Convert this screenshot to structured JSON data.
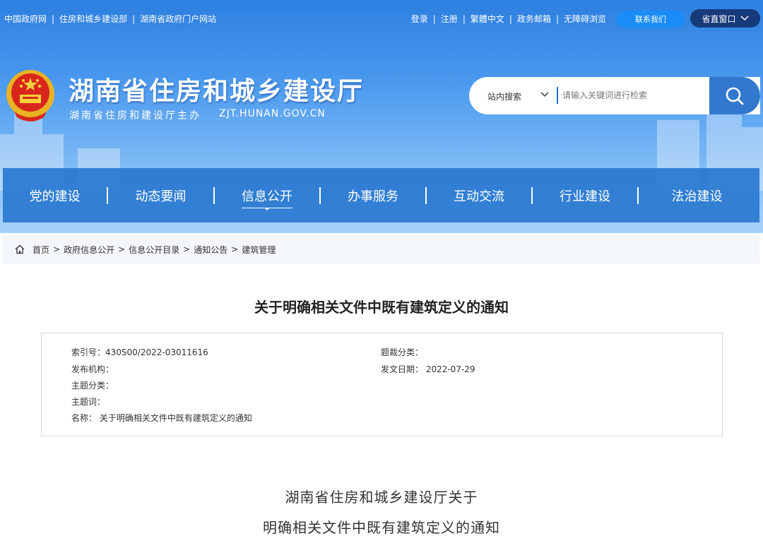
{
  "topbar": {
    "left_links": [
      "中国政府网",
      "住房和城乡建设部",
      "湖南省政府门户网站"
    ],
    "right_links": [
      "登录",
      "注册",
      "繁體中文",
      "政务邮箱",
      "无障碍浏览"
    ],
    "contact_button": "联系我们",
    "province_button": "省直窗口"
  },
  "header": {
    "title": "湖南省住房和城乡建设厅",
    "subtitle": "湖南省住房和建设厅主办",
    "url": "ZJT.HUNAN.GOV.CN"
  },
  "search": {
    "scope": "站内搜索",
    "placeholder": "请输入关键词进行检索"
  },
  "nav": {
    "items": [
      {
        "label": "党的建设"
      },
      {
        "label": "动态要闻"
      },
      {
        "label": "信息公开"
      },
      {
        "label": "办事服务"
      },
      {
        "label": "互动交流"
      },
      {
        "label": "行业建设"
      },
      {
        "label": "法治建设"
      }
    ],
    "active_index": 2
  },
  "breadcrumb": [
    "首页",
    "政府信息公开",
    "信息公开目录",
    "通知公告",
    "建筑管理"
  ],
  "article": {
    "title": "关于明确相关文件中既有建筑定义的通知",
    "meta": {
      "index_no": "索引号：430S00/2022-03011616",
      "genre": "题裁分类：",
      "publisher": "发布机构：",
      "date": "发文日期： 2022-07-29",
      "topic": "主题分类：",
      "keywords": "主题词：",
      "name": "名称： 关于明确相关文件中既有建筑定义的通知"
    },
    "body_lines": [
      "湖南省住房和城乡建设厅关于",
      "明确相关文件中既有建筑定义的通知"
    ]
  },
  "colors": {
    "header_blue": "#2d7fe0",
    "nav_blue": "#2978d0",
    "contact_blue": "#1a8cf7",
    "prov_navy": "#173a7a",
    "search_btn": "#3278ce"
  }
}
